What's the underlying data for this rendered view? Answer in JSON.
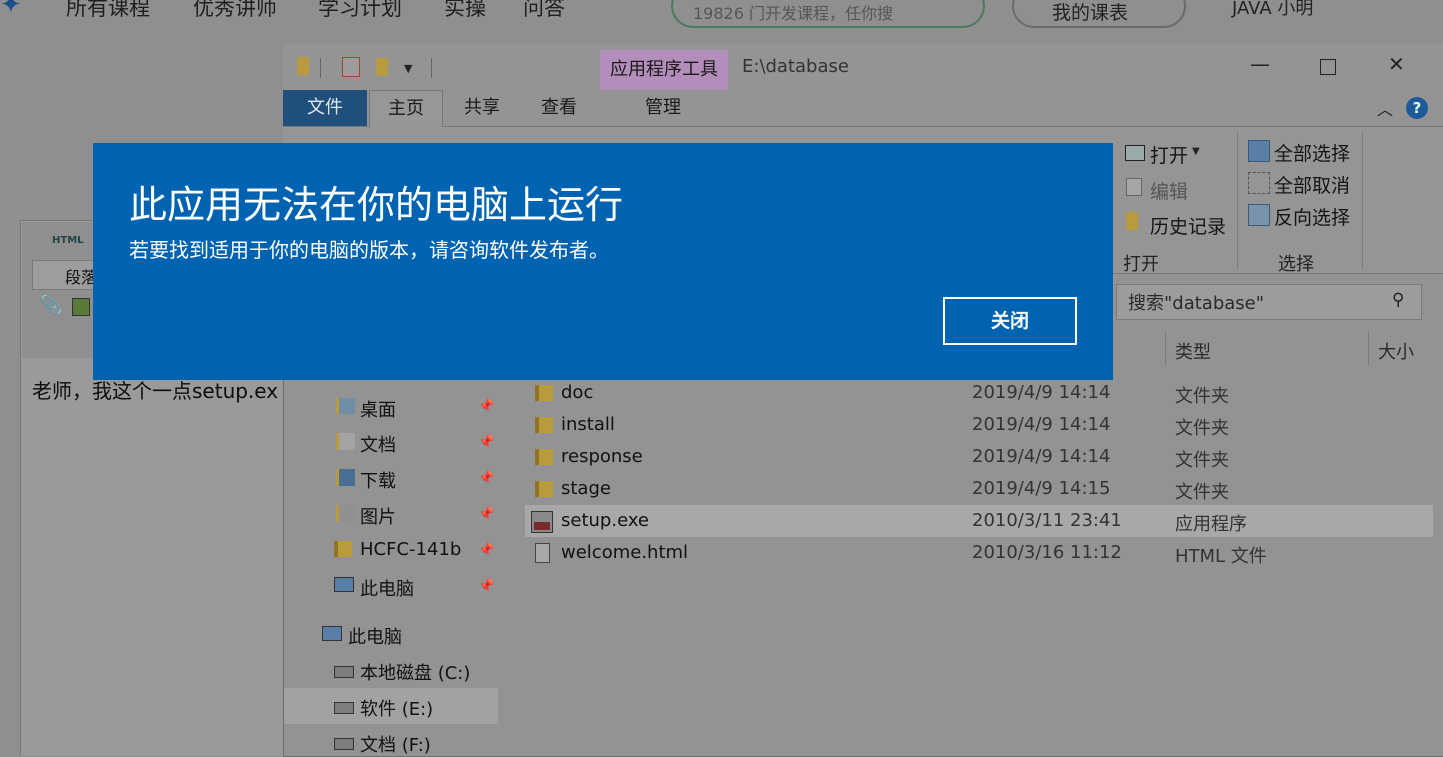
{
  "web": {
    "nav": [
      "所有课程",
      "优秀讲师",
      "学习计划",
      "实操",
      "问答"
    ],
    "search_partial": "19826 门开发课程，任你搜",
    "my_courses": "我的课表",
    "user_partial": "JAVA 小明",
    "editor": {
      "html_label": "HTML",
      "paragraph_select": "段落",
      "content": "老师，我这个一点setup.ex"
    }
  },
  "explorer": {
    "path_title": "E:\\database",
    "context_tab_group": "应用程序工具",
    "tabs": [
      "文件",
      "主页",
      "共享",
      "查看",
      "管理"
    ],
    "ribbon": {
      "open_label": "打开",
      "edit_label": "编辑",
      "history_label": "历史记录",
      "open_group": "打开",
      "select_all": "全部选择",
      "select_none": "全部取消",
      "invert_select": "反向选择",
      "select_group": "选择"
    },
    "search_placeholder": "搜索\"database\"",
    "columns": {
      "type": "类型",
      "size": "大小"
    },
    "nav": [
      {
        "label": "桌面",
        "pinned": true
      },
      {
        "label": "文档",
        "pinned": true
      },
      {
        "label": "下载",
        "pinned": true
      },
      {
        "label": "图片",
        "pinned": true
      },
      {
        "label": "HCFC-141b",
        "pinned": true
      },
      {
        "label": "此电脑",
        "pinned": true
      }
    ],
    "nav_tree": [
      {
        "label": "此电脑"
      },
      {
        "label": "本地磁盘 (C:)"
      },
      {
        "label": "软件 (E:)",
        "selected": true
      },
      {
        "label": "文档 (F:)"
      }
    ],
    "files": [
      {
        "name": "doc",
        "date": "2019/4/9 14:14",
        "type": "文件夹",
        "icon": "folder-icon"
      },
      {
        "name": "install",
        "date": "2019/4/9 14:14",
        "type": "文件夹",
        "icon": "folder-icon"
      },
      {
        "name": "response",
        "date": "2019/4/9 14:14",
        "type": "文件夹",
        "icon": "folder-icon"
      },
      {
        "name": "stage",
        "date": "2019/4/9 14:15",
        "type": "文件夹",
        "icon": "folder-icon"
      },
      {
        "name": "setup.exe",
        "date": "2010/3/11 23:41",
        "type": "应用程序",
        "icon": "exe-icon",
        "selected": true
      },
      {
        "name": "welcome.html",
        "date": "2010/3/16 11:12",
        "type": "HTML 文件",
        "icon": "html-file-icon"
      }
    ]
  },
  "dialog": {
    "title": "此应用无法在你的电脑上运行",
    "message": "若要找到适用于你的电脑的版本，请咨询软件发布者。",
    "close_button": "关闭",
    "accent_color": "#0063b1"
  }
}
